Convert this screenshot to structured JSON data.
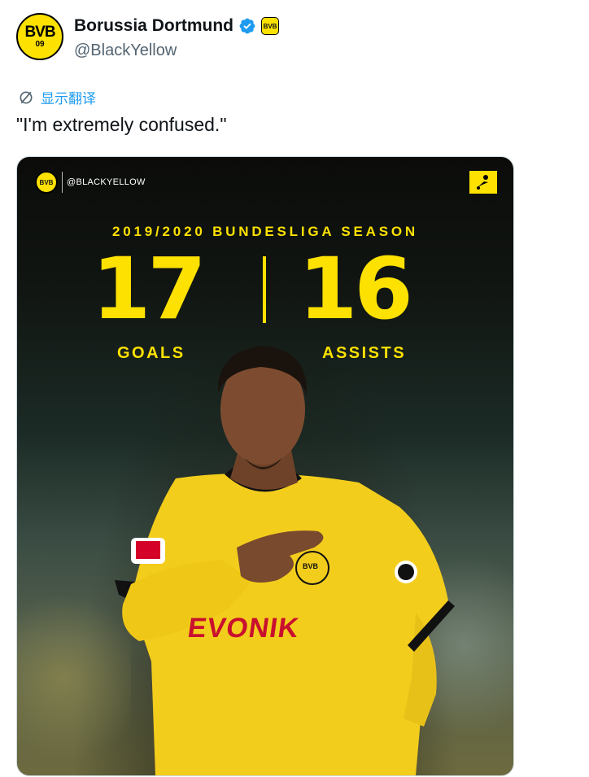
{
  "tweet": {
    "display_name": "Borussia Dortmund",
    "handle": "@BlackYellow",
    "translate_label": "显示翻译",
    "text": "\"I'm extremely confused.\""
  },
  "avatar": {
    "crest_text": "BVB",
    "crest_number": "09"
  },
  "media": {
    "overlay_handle": "@BLACKYELLOW",
    "season": "2019/2020 BUNDESLIGA SEASON",
    "goals_value": "17",
    "goals_label": "GOALS",
    "assists_value": "16",
    "assists_label": "ASSISTS",
    "sponsor": "EVONIK",
    "shirt_crest": "BVB"
  },
  "icons": {
    "verified": "verified-badge-icon",
    "affiliate": "bvb-affiliate-icon",
    "translate": "translate-icon",
    "bundesliga": "bundesliga-logo-icon"
  },
  "colors": {
    "brand_yellow": "#fde100",
    "link_blue": "#1d9bf0",
    "verified_blue": "#1d9bf0"
  }
}
